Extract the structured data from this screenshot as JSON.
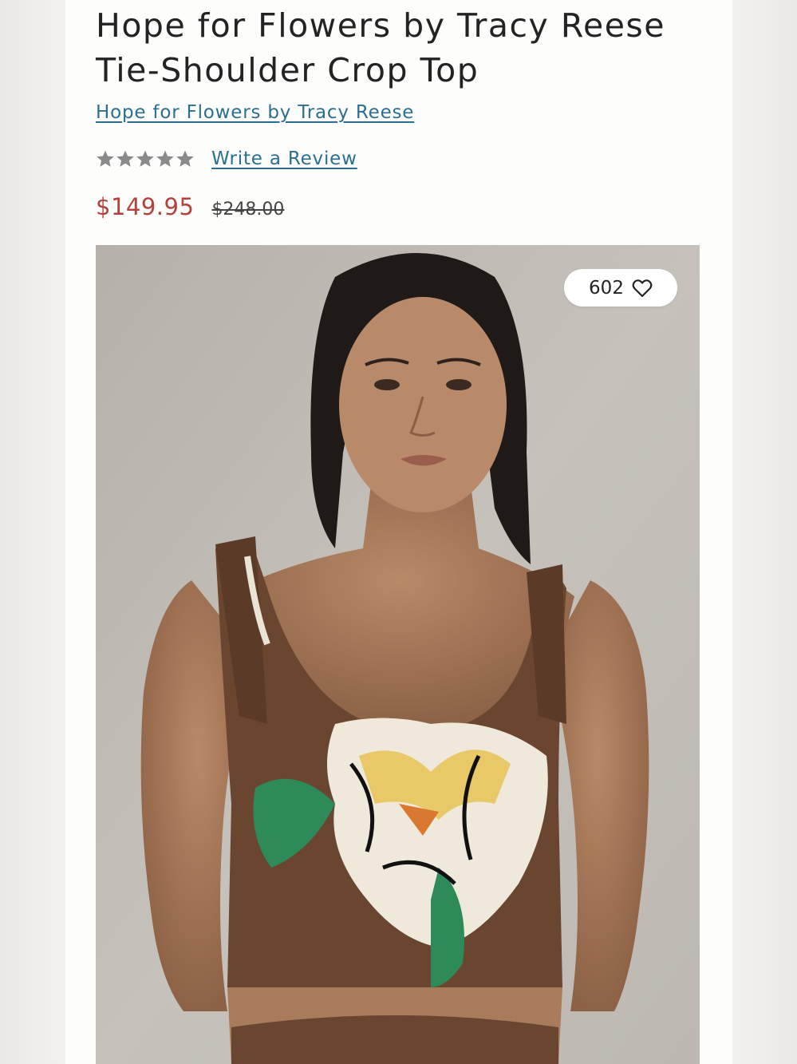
{
  "product": {
    "title": "Hope for Flowers by Tracy Reese Tie-Shoulder Crop Top",
    "brand_link": "Hope for Flowers by Tracy Reese",
    "review_link": "Write a Review",
    "rating_stars": 5,
    "price_sale": "$149.95",
    "price_original": "$248.00",
    "favorites_count": "602"
  },
  "icons": {
    "star": "star-icon",
    "heart": "heart-icon"
  },
  "colors": {
    "link": "#2a6f8f",
    "sale_price": "#b4423c",
    "star": "#8a8a8a",
    "text": "#232323"
  }
}
